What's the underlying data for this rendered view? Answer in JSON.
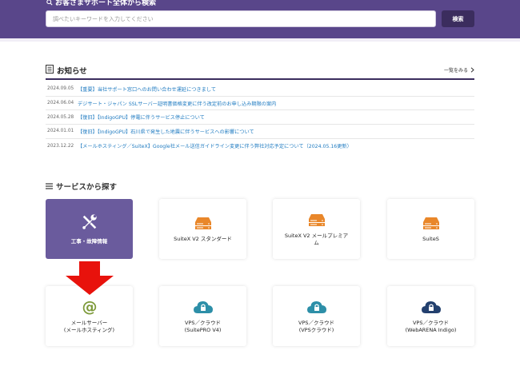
{
  "hero": {
    "title": "お客さまサポート全体から検索",
    "search_placeholder": "調べたいキーワードを入力してください",
    "search_button": "検索"
  },
  "news": {
    "title": "お知らせ",
    "more_label": "一覧をみる",
    "items": [
      {
        "date": "2024.09.05",
        "text": "【重要】当社サポート窓口へのお問い合わせ運延につきまして"
      },
      {
        "date": "2024.06.04",
        "text": "デジサート・ジャパン SSLサーバー証明書価格変更に伴う改定前のお申し込み期限の案内"
      },
      {
        "date": "2024.05.28",
        "text": "【復旧】【IndigoGPU】停電に伴うサービス停止について"
      },
      {
        "date": "2024.01.01",
        "text": "【復旧】【IndigoGPU】石川県で発生した地震に伴うサービスへの影響について"
      },
      {
        "date": "2023.12.22",
        "text": "【メールホスティング／SuiteX】Google社メール送信ガイドライン変更に伴う弊社対応予定について（2024.05.16更新）"
      }
    ]
  },
  "services": {
    "title": "サービスから探す",
    "cards": [
      {
        "line1": "工事・故障情報",
        "line2": "",
        "icon": "tools-icon"
      },
      {
        "line1": "SuiteX V2 スタンダード",
        "line2": "",
        "icon": "server-icon"
      },
      {
        "line1": "SuiteX V2 メールプレミア",
        "line2": "ム",
        "icon": "server-icon"
      },
      {
        "line1": "SuiteS",
        "line2": "",
        "icon": "server-icon"
      },
      {
        "line1": "メールサーバー",
        "line2": "(メールホスティング)",
        "icon": "at-icon"
      },
      {
        "line1": "VPS／クラウド",
        "line2": "(SuitePRO V4)",
        "icon": "cloud-lock-icon"
      },
      {
        "line1": "VPS／クラウド",
        "line2": "(VPSクラウド)",
        "icon": "cloud-lock-icon"
      },
      {
        "line1": "VPS／クラウド",
        "line2": "(WebARENA Indigo)",
        "icon": "cloud-lock-icon"
      }
    ]
  },
  "colors": {
    "brand_purple": "#59468a",
    "card_purple": "#6a5b9d",
    "link_blue": "#1f7bc1",
    "server_orange": "#e9872a",
    "cloud_teal": "#2d8fa8",
    "cloud_navy": "#23406e",
    "at_green": "#7d9a3a",
    "arrow_red": "#e8120c"
  }
}
